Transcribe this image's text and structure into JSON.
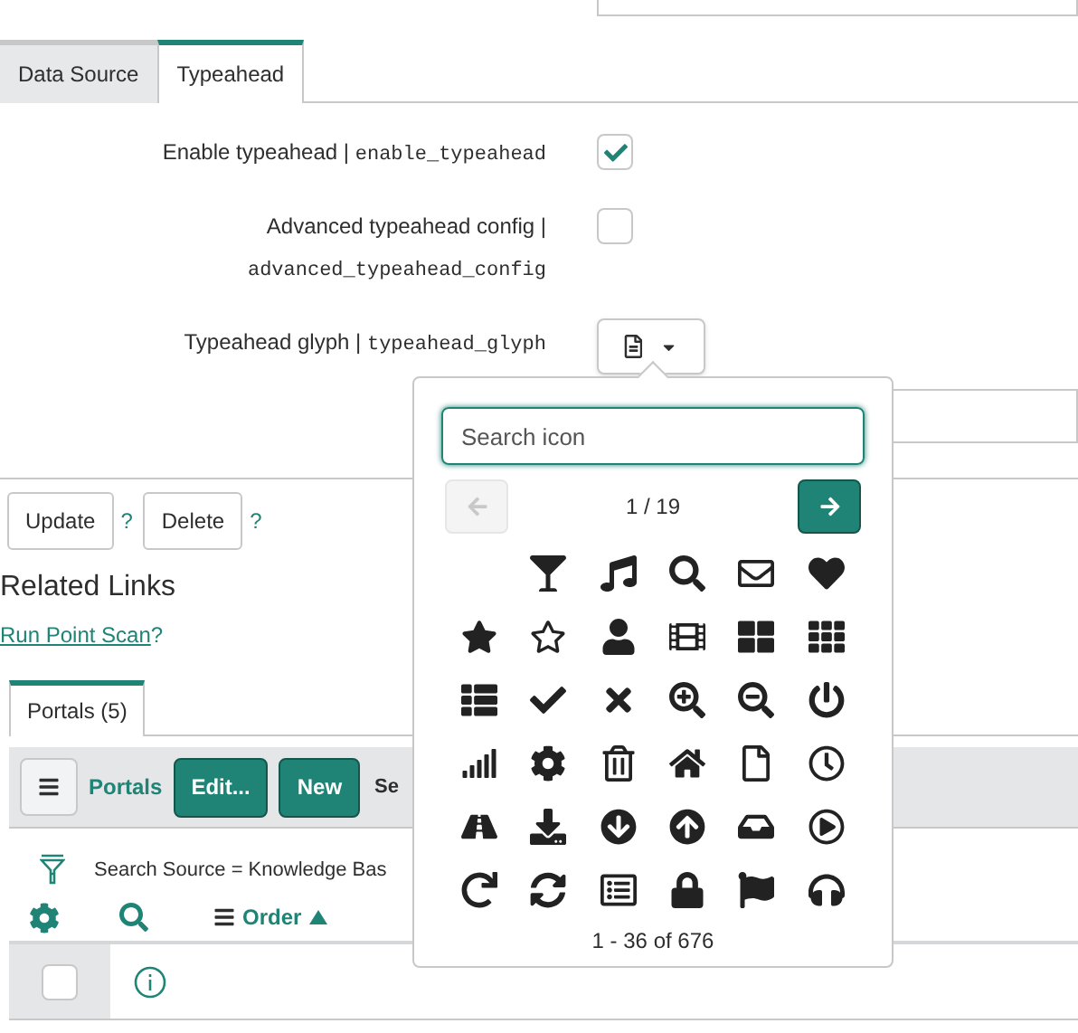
{
  "tabs": [
    {
      "label": "Data Source",
      "selected": false
    },
    {
      "label": "Typeahead",
      "selected": true
    }
  ],
  "fields": [
    {
      "kind": "checkbox",
      "label": "Enable typeahead |",
      "name": "enable_typeahead",
      "checked": true
    },
    {
      "kind": "checkbox",
      "label": "Advanced typeahead config |",
      "name": "advanced_typeahead_config",
      "checked": false
    },
    {
      "kind": "glyph",
      "label": "Typeahead glyph |",
      "name": "typeahead_glyph"
    }
  ],
  "form_buttons": [
    {
      "label": "Update",
      "help": "?"
    },
    {
      "label": "Delete",
      "help": "?"
    }
  ],
  "related_links": {
    "title": "Related Links",
    "links": [
      {
        "label": "Run Point Scan",
        "help": "?"
      }
    ]
  },
  "related_list": {
    "tabs": [
      {
        "label": "Portals (5)",
        "selected": true
      }
    ],
    "toolbar": {
      "title": "Portals",
      "buttons": [
        "Edit...",
        "New"
      ],
      "column_3": "Se"
    },
    "filter": "Search Source = Knowledge Bas",
    "columns": [
      {
        "label": "Order",
        "sort_ascending": true
      }
    ],
    "rows": [
      {
        "checked": false
      }
    ]
  },
  "glyph_picker": {
    "search": {
      "placeholder": "Search icon"
    },
    "prev": {
      "disabled": true
    },
    "page": "1 / 19",
    "next": {
      "disabled": false
    },
    "range": "1 - 36 of 676"
  }
}
